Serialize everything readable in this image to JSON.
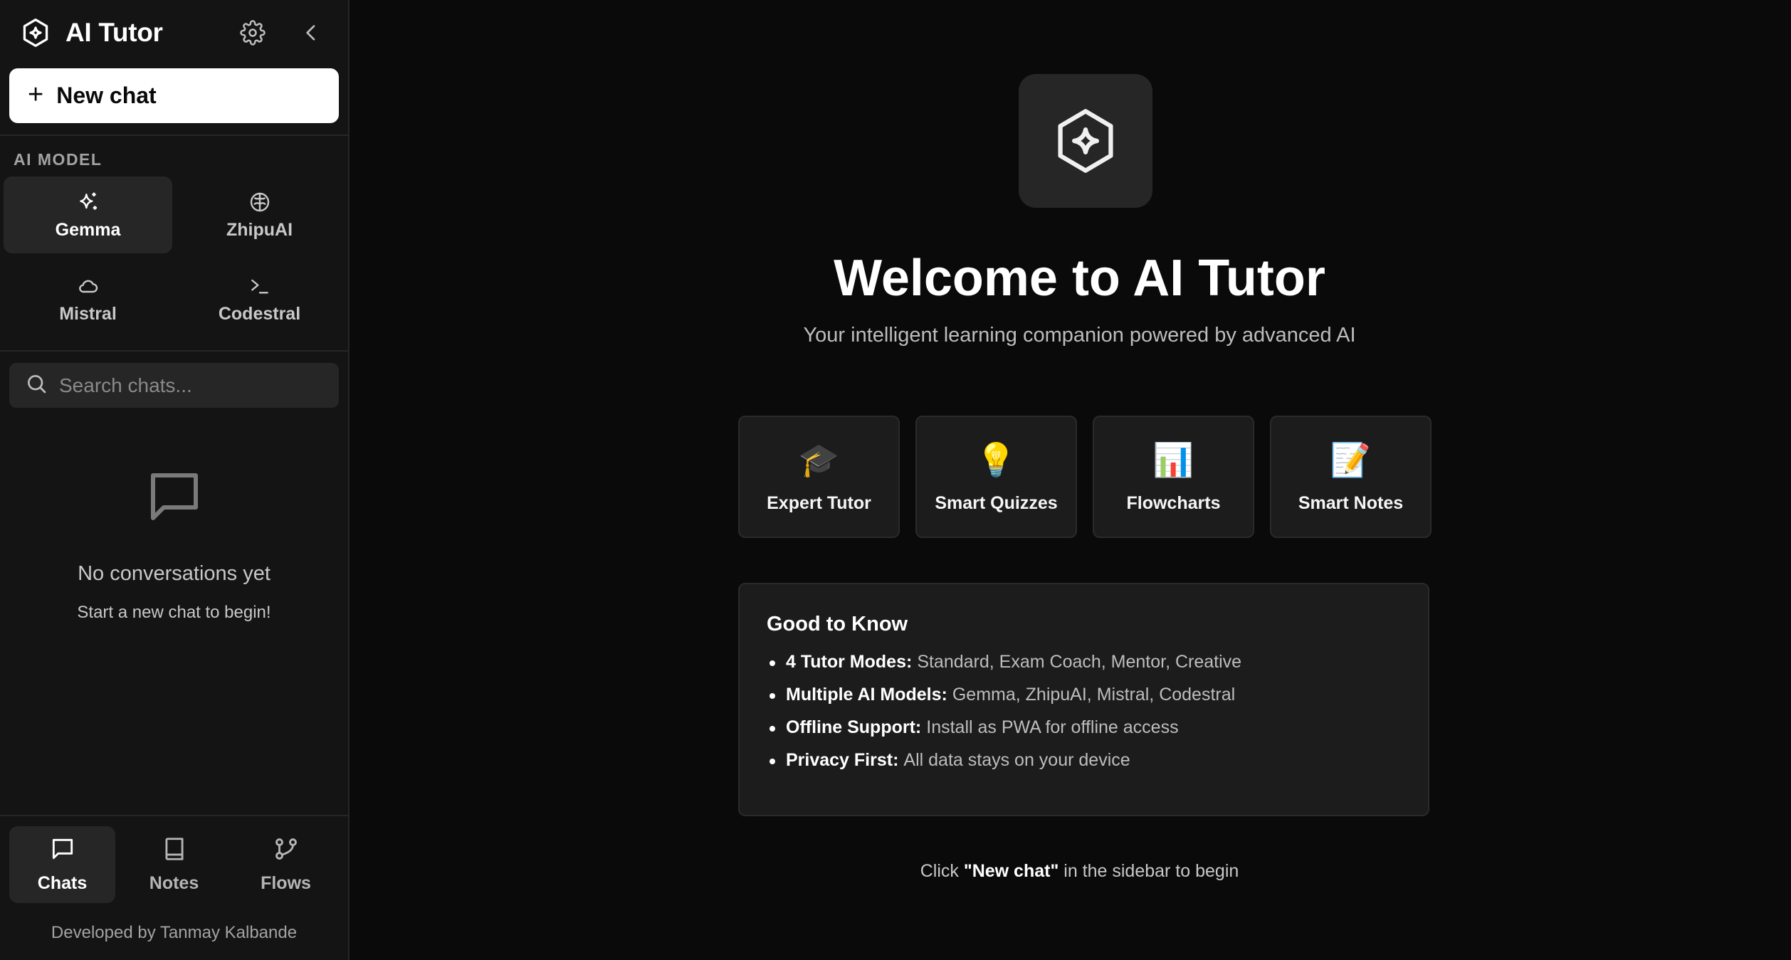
{
  "app": {
    "title": "AI Tutor"
  },
  "sidebar": {
    "new_chat_label": "New chat",
    "model_section_label": "AI MODEL",
    "models": [
      {
        "label": "Gemma",
        "icon": "sparkles-icon",
        "active": true
      },
      {
        "label": "ZhipuAI",
        "icon": "brain-icon",
        "active": false
      },
      {
        "label": "Mistral",
        "icon": "cloud-icon",
        "active": false
      },
      {
        "label": "Codestral",
        "icon": "terminal-icon",
        "active": false
      }
    ],
    "search": {
      "placeholder": "Search chats..."
    },
    "empty": {
      "title": "No conversations yet",
      "subtitle": "Start a new chat to begin!"
    },
    "nav": [
      {
        "label": "Chats",
        "icon": "message-square-icon",
        "active": true
      },
      {
        "label": "Notes",
        "icon": "book-icon",
        "active": false
      },
      {
        "label": "Flows",
        "icon": "git-branch-icon",
        "active": false
      }
    ],
    "credit": "Developed by Tanmay Kalbande"
  },
  "main": {
    "welcome_title": "Welcome to AI Tutor",
    "tagline": "Your intelligent learning companion powered by advanced AI",
    "features": [
      {
        "label": "Expert Tutor",
        "emoji": "🎓"
      },
      {
        "label": "Smart Quizzes",
        "emoji": "💡"
      },
      {
        "label": "Flowcharts",
        "emoji": "📊"
      },
      {
        "label": "Smart Notes",
        "emoji": "📝"
      }
    ],
    "good_to_know": {
      "title": "Good to Know",
      "items": [
        {
          "key": "4 Tutor Modes:",
          "text": "Standard, Exam Coach, Mentor, Creative"
        },
        {
          "key": "Multiple AI Models:",
          "text": "Gemma, ZhipuAI, Mistral, Codestral"
        },
        {
          "key": "Offline Support:",
          "text": "Install as PWA for offline access"
        },
        {
          "key": "Privacy First:",
          "text": "All data stays on your device"
        }
      ]
    },
    "hint": {
      "prefix": "Click",
      "emphasis": "\"New chat\"",
      "suffix": "in the sidebar to begin"
    }
  },
  "colors": {
    "background": "#0a0a0a",
    "sidebar": "#141414",
    "card": "#1c1c1c",
    "active": "#262626",
    "primary_button": "#ffffff"
  }
}
